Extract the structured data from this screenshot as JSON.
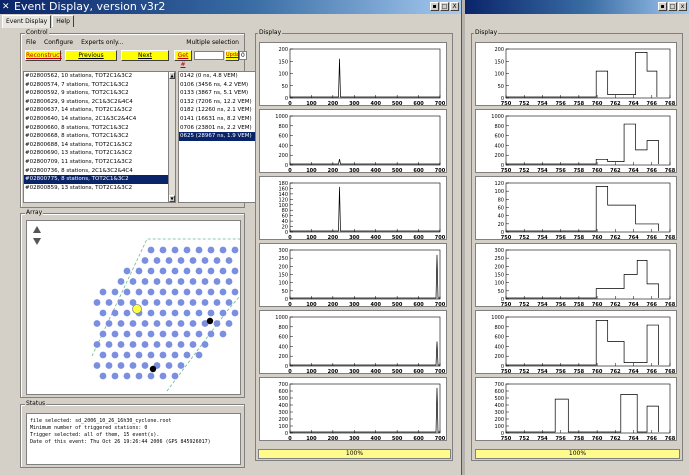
{
  "window": {
    "title": "Event Display, version v3r2",
    "close_glyph": "X",
    "min_glyph": "▪",
    "max_glyph": "□",
    "close2": "x"
  },
  "tabs": [
    {
      "label": "Event Display"
    },
    {
      "label": "Help"
    }
  ],
  "control": {
    "title": "Control",
    "menus": [
      "File",
      "Configure",
      "Experts only..."
    ],
    "multiple_selection": "Multiple selection",
    "buttons": {
      "reconstruct": "Reconstruct",
      "previous": "Previous",
      "next": "Next",
      "get": "Get #",
      "update": "Update"
    },
    "update_value": "0",
    "events": [
      "#02800562, 10 stations, TOT2C1&3C2",
      "#02800574, 7 stations, TOT2C1&3C2",
      "#02800592, 9 stations, TOT2C1&3C2",
      "#02800629, 9 stations, 2C1&3C2&4C4",
      "#02800637, 14 stations, TOT2C1&3C2",
      "#02800640, 14 stations, 2C1&3C2&4C4",
      "#02800660, 8 stations, TOT2C1&3C2",
      "#02800668, 8 stations, TOT2C1&3C2",
      "#02800688, 14 stations, TOT2C1&3C2",
      "#02800690, 13 stations, TOT2C1&3C2",
      "#02800709, 11 stations, TOT2C1&3C2",
      "#02800736, 8 stations, 2C1&3C2&4C4",
      "#02800775, 8 stations, TOT2C1&3C2",
      "#02800859, 13 stations, TOT2C1&3C2"
    ],
    "selected_event": 12,
    "stations": [
      "0142 (0 ns, 4.8 VEM)",
      "0106 (3456 ns, 4.2 VEM)",
      "0133 (3867 ns, 5.1 VEM)",
      "0132 (7206 ns, 12.2 VEM)",
      "0182 (12260 ns, 2.1 VEM)",
      "0141 (16631 ns, 8.2 VEM)",
      "0706 (23801 ns, 2.2 VEM)",
      "0625 (28967 ns, 1.9 VEM)"
    ],
    "selected_station": 7
  },
  "array": {
    "title": "Array"
  },
  "status": {
    "title": "Status",
    "lines": [
      "file selected: sd_2006_10_26_16h30_cyclone.root",
      "Minimum number of triggered stations: 0",
      "Trigger selected: all of them, 15 event(s).",
      "Date of this event: Thu Oct 26 19:26:44 2006 (GPS 845926017)"
    ]
  },
  "display1": {
    "title": "Display",
    "progress": "100%",
    "x_ticks": [
      "0",
      "100",
      "200",
      "300",
      "400",
      "500",
      "600",
      "700"
    ],
    "plots": [
      {
        "yticks": [
          "200",
          "150",
          "100",
          "50",
          "0"
        ]
      },
      {
        "yticks": [
          "1000",
          "800",
          "600",
          "400",
          "200",
          "0"
        ]
      },
      {
        "yticks": [
          "180",
          "160",
          "140",
          "120",
          "100",
          "80",
          "60",
          "40",
          "20",
          "0"
        ]
      },
      {
        "yticks": [
          "300",
          "250",
          "200",
          "150",
          "100",
          "50",
          "0"
        ]
      },
      {
        "yticks": [
          "1000",
          "800",
          "600",
          "400",
          "200",
          "0"
        ]
      },
      {
        "yticks": [
          "700",
          "600",
          "500",
          "400",
          "300",
          "200",
          "100",
          "0"
        ]
      }
    ]
  },
  "display2": {
    "title": "Display",
    "progress": "100%",
    "x_ticks": [
      "750",
      "752",
      "754",
      "756",
      "758",
      "760",
      "762",
      "764",
      "766",
      "768"
    ],
    "plots": [
      {
        "yticks": [
          "200",
          "150",
          "100",
          "50",
          "0"
        ]
      },
      {
        "yticks": [
          "1000",
          "800",
          "600",
          "400",
          "200",
          "0"
        ]
      },
      {
        "yticks": [
          "120",
          "100",
          "80",
          "60",
          "40",
          "20",
          "0"
        ]
      },
      {
        "yticks": [
          "300",
          "250",
          "200",
          "150",
          "100",
          "50",
          "0"
        ]
      },
      {
        "yticks": [
          "1000",
          "800",
          "600",
          "400",
          "200",
          "0"
        ]
      },
      {
        "yticks": [
          "700",
          "600",
          "500",
          "400",
          "300",
          "200",
          "100",
          "0"
        ]
      }
    ]
  },
  "colors": {
    "accent": "#0a246a",
    "yellow_button": "#ffff00",
    "station": "#7b8fe0",
    "progress": "#fffb8c"
  }
}
